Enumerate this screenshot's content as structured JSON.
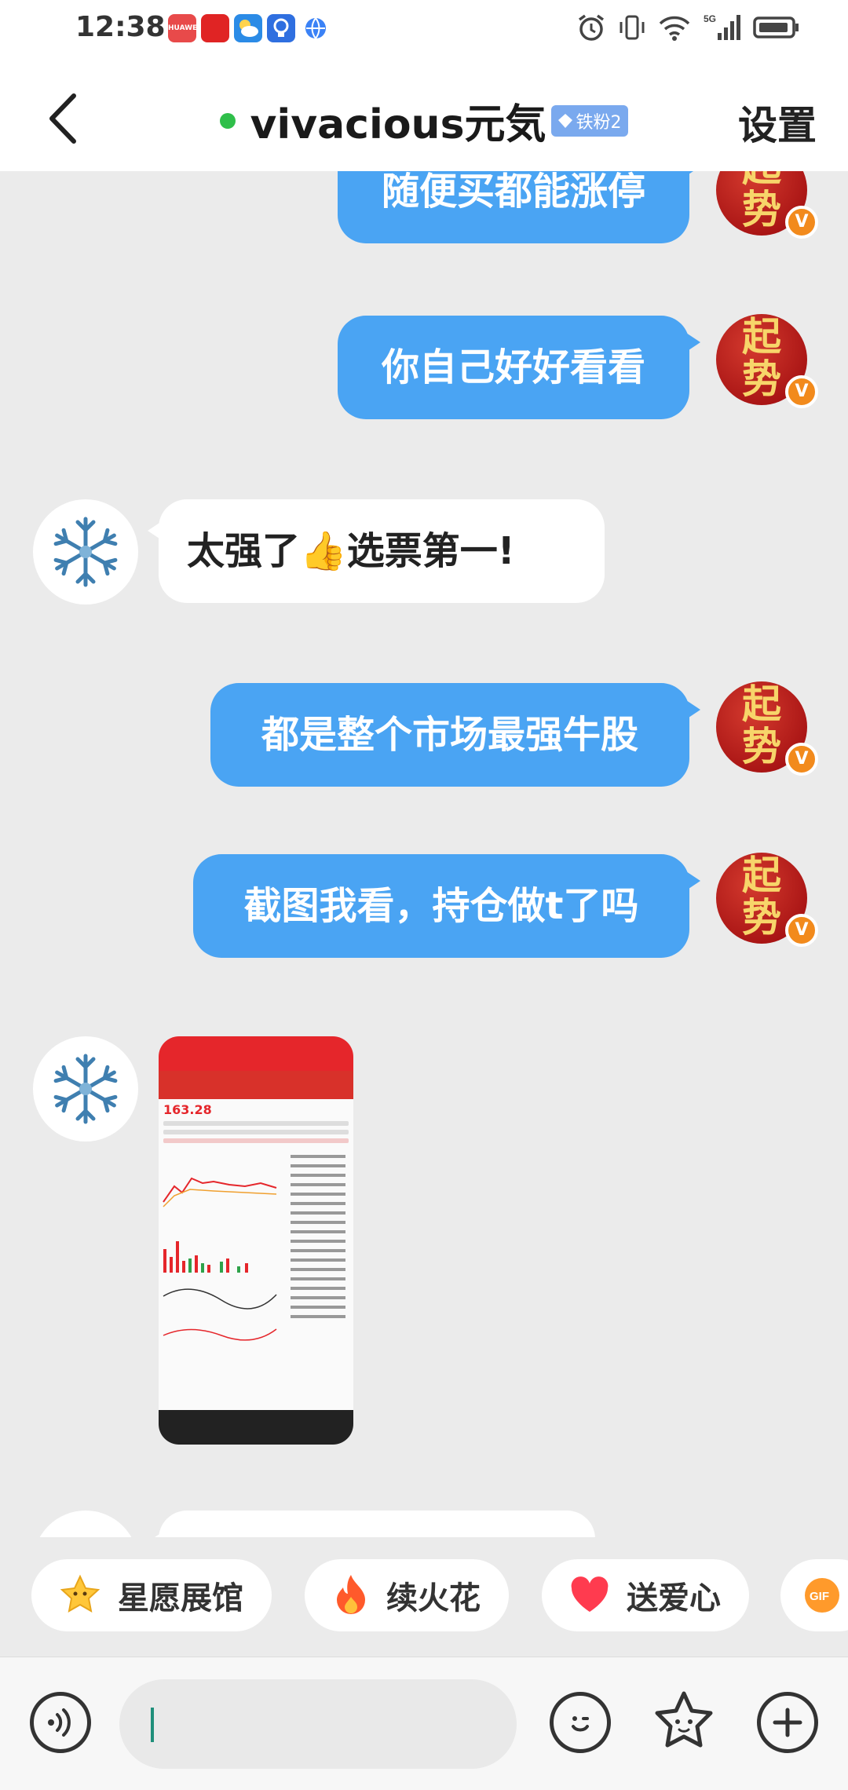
{
  "status_bar": {
    "time": "12:38",
    "apps": [
      {
        "name": "huawei-app",
        "label": "HUAWEI",
        "color": "#e84a4a"
      },
      {
        "name": "news-app",
        "label": "",
        "color": "#e02424"
      },
      {
        "name": "weather-app",
        "label": "",
        "color": "#2b8be6"
      },
      {
        "name": "bulb-app",
        "label": "",
        "color": "#2f6fe0"
      },
      {
        "name": "globe-app",
        "label": "",
        "color": "#3b82f6"
      }
    ],
    "network": "5G"
  },
  "header": {
    "title": "vivacious元気",
    "fan_badge": "铁粉2",
    "settings_label": "设置",
    "online_color": "#2fbf4a"
  },
  "avatars": {
    "self_text": "起势",
    "self_badge": "V"
  },
  "messages": [
    {
      "side": "right",
      "text": "随便买都能涨停"
    },
    {
      "side": "right",
      "text": "你自己好好看看"
    },
    {
      "side": "left",
      "text": "太强了👍选票第一!"
    },
    {
      "side": "right",
      "text": "都是整个市场最强牛股"
    },
    {
      "side": "right",
      "text": "截图我看，持仓做t了吗"
    },
    {
      "side": "left",
      "type": "image",
      "image_price": "163.28"
    }
  ],
  "quick_actions": [
    {
      "label": "星愿展馆",
      "icon": "star-icon"
    },
    {
      "label": "续火花",
      "icon": "flame-icon"
    },
    {
      "label": "送爱心",
      "icon": "heart-icon"
    },
    {
      "label": "GIF",
      "icon": "gif-icon"
    }
  ],
  "input": {
    "placeholder": "",
    "value": ""
  },
  "colors": {
    "bubble_self": "#4aa4f3",
    "bubble_other": "#ffffff",
    "background": "#ebebeb"
  }
}
